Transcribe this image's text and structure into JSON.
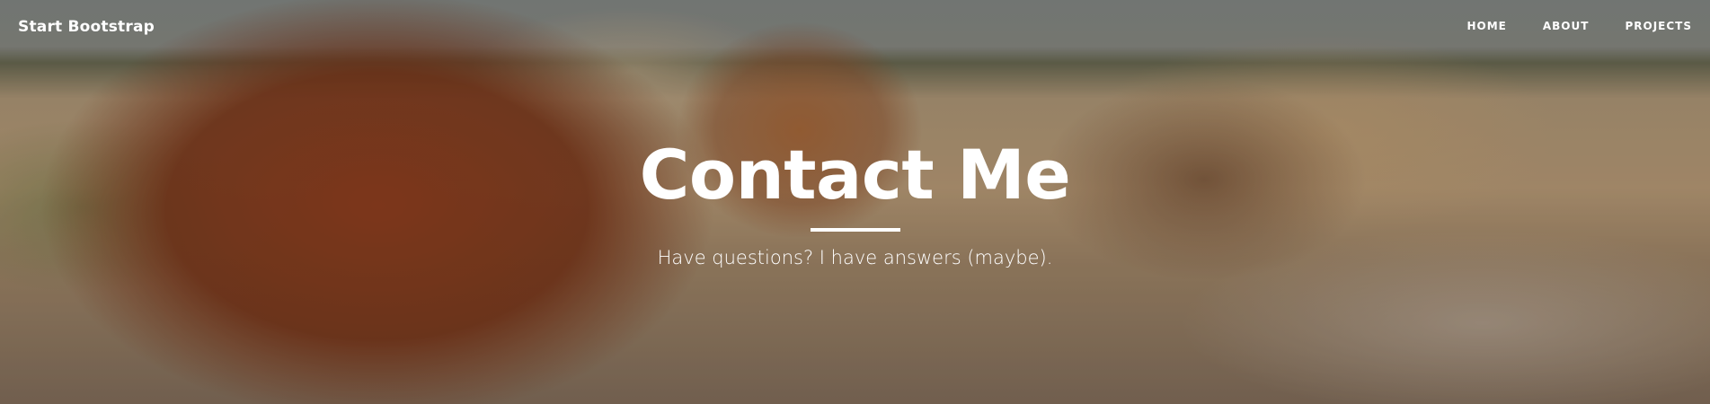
{
  "navbar": {
    "brand": "Start Bootstrap",
    "links": [
      {
        "label": "HOME"
      },
      {
        "label": "ABOUT"
      },
      {
        "label": "PROJECTS"
      }
    ]
  },
  "header": {
    "title": "Contact Me",
    "subheading": "Have questions? I have answers (maybe)."
  }
}
